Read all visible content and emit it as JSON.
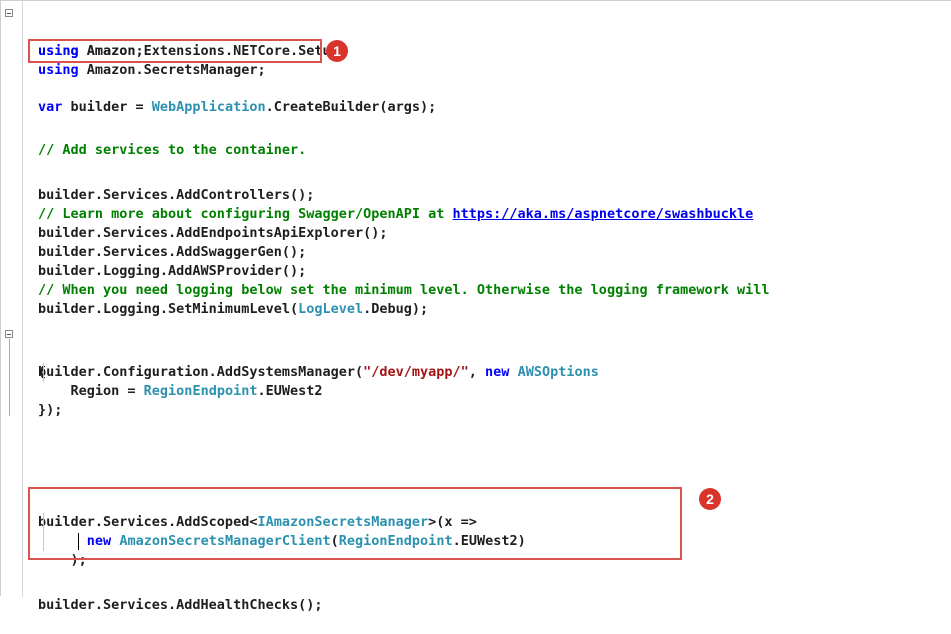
{
  "lines": {
    "l1": {
      "kw": "using",
      "rest": " Amazon;"
    },
    "l2": {
      "kw": "using",
      "rest": " Amazon.Extensions.NETCore.Setup;"
    },
    "l3": {
      "kw": "using",
      "rest": " Amazon.SecretsManager;"
    },
    "l4": {
      "kw": "var",
      "t1": " builder = ",
      "ty1": "WebApplication",
      "t2": ".CreateBuilder(args);"
    },
    "l5": {
      "cm": "// Add services to the container."
    },
    "l6": {
      "t1": "builder.Services.AddControllers();"
    },
    "l7": {
      "cm": "// Learn more about configuring Swagger/OpenAPI at ",
      "link": "https://aka.ms/aspnetcore/swashbuckle"
    },
    "l8": {
      "t1": "builder.Services.AddEndpointsApiExplorer();"
    },
    "l9": {
      "t1": "builder.Services.AddSwaggerGen();"
    },
    "l10": {
      "t1": "builder.Logging.AddAWSProvider();"
    },
    "l11": {
      "cm": "// When you need logging below set the minimum level. Otherwise the logging framework will"
    },
    "l12": {
      "t1": "builder.Logging.SetMinimumLevel(",
      "ty1": "LogLevel",
      "t2": ".Debug);"
    },
    "l13": {
      "t1": "builder.Configuration.AddSystemsManager(",
      "st": "\"/dev/myapp/\"",
      "t2": ", ",
      "kw": "new",
      "t3": " ",
      "ty1": "AWSOptions"
    },
    "l14": {
      "t1": "{"
    },
    "l15": {
      "t1": "    Region = ",
      "ty1": "RegionEndpoint",
      "t2": ".EUWest2"
    },
    "l16": {
      "t1": "});"
    },
    "l17": {
      "t1": "builder.Services.AddScoped<",
      "ty1": "IAmazonSecretsManager",
      "t2": ">(x =>"
    },
    "l18": {
      "t0": "      ",
      "kw": "new",
      "t1": " ",
      "ty1": "AmazonSecretsManagerClient",
      "t2": "(",
      "ty2": "RegionEndpoint",
      "t3": ".EUWest2)"
    },
    "l19": {
      "t1": "    );"
    },
    "l20": {
      "t1": "builder.Services.AddHealthChecks();"
    }
  },
  "annotations": {
    "badge1": "1",
    "badge2": "2"
  },
  "colors": {
    "keyword": "#0000ff",
    "type": "#2b91af",
    "comment": "#008000",
    "string": "#a31515",
    "highlight": "#d9342b"
  }
}
